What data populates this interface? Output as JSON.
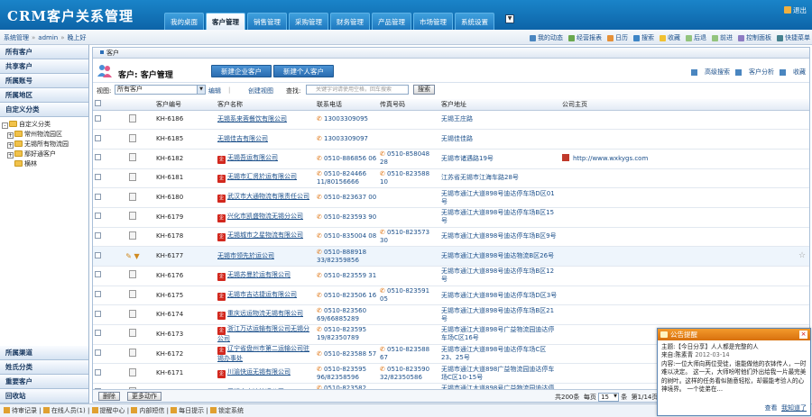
{
  "app": {
    "title": "CRM客户关系管理",
    "logout": "退出",
    "nav_tabs": [
      "我的桌面",
      "客户管理",
      "销售管理",
      "采购管理",
      "财务管理",
      "产品管理",
      "市场管理",
      "系统设置"
    ],
    "active_tab": 1
  },
  "breadcrumb": {
    "root": "系统管理",
    "user": "admin",
    "greeting": "晚上好"
  },
  "toolbar": [
    "我的动态",
    "经营报表",
    "日历",
    "搜索",
    "收藏",
    "后退",
    "前进",
    "控制面板",
    "快捷菜单"
  ],
  "sidebar": {
    "top_items": [
      "所有客户",
      "共享客户",
      "所属账号",
      "所属地区",
      "自定义分类"
    ],
    "tree": {
      "root": "自定义分类",
      "children": [
        "常州物流园区",
        "无锡所有物流园",
        "鄢好通客户",
        "横林"
      ]
    },
    "bottom_items": [
      "所属渠道",
      "姓氏分类",
      "重要客户",
      "回收站"
    ]
  },
  "main": {
    "panel_title": "客户",
    "page_title": "客户: 客户管理",
    "btn_new_company": "新建企业客户",
    "btn_new_person": "新建个人客户",
    "title_links": [
      "高级搜索",
      "客户分析",
      "收藏"
    ],
    "view_label": "视图:",
    "view_value": "所有客户",
    "edit_link": "编辑",
    "create_view_link": "创建视图",
    "search_label": "查找:",
    "search_placeholder": "关键字词请使用空格，回车搜索",
    "search_btn": "搜索"
  },
  "table": {
    "columns": [
      "客户编号",
      "客户名称",
      "联系电话",
      "传真号码",
      "客户地址",
      "公司主页"
    ],
    "rows": [
      {
        "id": "KH-6186",
        "name": "无锡系来蓉餐饮有限公司",
        "badge": false,
        "phone": "13003309095",
        "fax": "",
        "addr": "无锡王庄路",
        "site": ""
      },
      {
        "id": "KH-6185",
        "name": "无锡佳吉有限公司",
        "badge": false,
        "phone": "13003309097",
        "fax": "",
        "addr": "无锡佳佳路",
        "site": ""
      },
      {
        "id": "KH-6182",
        "name": "无锡吾运有限公司",
        "badge": true,
        "phone": "0510-886856 06",
        "fax": "0510-858048 28",
        "addr": "无锡市诸遇路19号",
        "site": "http://www.wxkygs.com"
      },
      {
        "id": "KH-6181",
        "name": "无锡市汇贤於运有限公司",
        "badge": true,
        "phone": "0510-824466 11/80156666",
        "fax": "0510-823588 10",
        "addr": "江苏省无锡市江海车路28号",
        "site": ""
      },
      {
        "id": "KH-6180",
        "name": "武汉市大通物流有限责任公司",
        "badge": true,
        "phone": "0510-823637 00",
        "fax": "",
        "addr": "无锡市通江大道898号迪达停车场D区01号",
        "site": ""
      },
      {
        "id": "KH-6179",
        "name": "兴化市凯盛物流无锡分公司",
        "badge": true,
        "phone": "0510-823593 90",
        "fax": "",
        "addr": "无锡市通江大道898号迪达停车场B区15号",
        "site": ""
      },
      {
        "id": "KH-6178",
        "name": "无锡城市之星物流有限公司",
        "badge": true,
        "phone": "0510-835004 08",
        "fax": "0510-823573 30",
        "addr": "无锡市通江大道898号迪达停车场B区9号",
        "site": ""
      },
      {
        "id": "KH-6177",
        "name": "无锡市领先於运公司",
        "badge": false,
        "phone": "0510-888918 33/82359856",
        "fax": "",
        "addr": "无锡市通江大道898号迪达物流B区26号",
        "site": ""
      },
      {
        "id": "KH-6176",
        "name": "无锡苏曼於运有限公司",
        "badge": true,
        "phone": "0510-823559 31",
        "fax": "",
        "addr": "无锡市通江大道898号迪达停车场B区12号",
        "site": ""
      },
      {
        "id": "KH-6175",
        "name": "无锡市吉达捷运有限公司",
        "badge": true,
        "phone": "0510-823506 16",
        "fax": "0510-823591 05",
        "addr": "无锡市通江大道898号迪达停车场D区3号",
        "site": ""
      },
      {
        "id": "KH-6174",
        "name": "重庆远运物流无锡有限公司",
        "badge": true,
        "phone": "0510-823560 69/66885289",
        "fax": "",
        "addr": "无锡市通江大道898号迪达停车场B区21号",
        "site": ""
      },
      {
        "id": "KH-6173",
        "name": "浙江万达运输有限公司无锡分公司",
        "badge": true,
        "phone": "0510-823595 19/82350789",
        "fax": "",
        "addr": "无锡市通江大道898号广益物流园迪达停车场C区16号",
        "site": ""
      },
      {
        "id": "KH-6172",
        "name": "辽宁省盘州市第二运输公司驻锡办事处",
        "badge": true,
        "phone": "0510-823588 57",
        "fax": "0510-823588 67",
        "addr": "无锡市通江大道898号迪达停车场C区23、25号",
        "site": ""
      },
      {
        "id": "KH-6171",
        "name": "川渝快运无锡有限公司",
        "badge": true,
        "phone": "0510-823595 96/82358596",
        "fax": "0510-823590 32/82350586",
        "addr": "无锡市通江大道898广益物流园迪达停车场C区10-15号",
        "site": ""
      },
      {
        "id": "KH-6170",
        "name": "无锡市宇达快运公司",
        "badge": true,
        "phone": "0510-823582 19/82358289",
        "fax": "",
        "addr": "无锡市通江大道898号广益物流园迪达停车场C区17号",
        "site": ""
      }
    ]
  },
  "footer": {
    "delete_btn": "删除",
    "more_btn": "更多动作",
    "total": "共200条",
    "per_page_label": "每页",
    "per_page": "15",
    "unit": "条",
    "page_info": "第1/14页"
  },
  "statusbar": [
    "待审记录",
    "在线人员(1)",
    "提醒中心",
    "内部短信",
    "每日提示",
    "锁定系统"
  ],
  "popup": {
    "title": "公告提醒",
    "subject": "主题:【今日分享】人人都是完整的人",
    "from_label": "来自:",
    "from": "陈素青",
    "date": "2012-03-14",
    "content": "内容:一位大师向两位受徒，谁能做他的衣钵传人，一时难以决定。      这一天，大师吩咐他们外出给我一片最完美的树叶。这样的任务看似随意轻松，却最能考验人的心神境界。      一个徒弟在…",
    "view": "查看",
    "mark_read": "我知道了"
  }
}
